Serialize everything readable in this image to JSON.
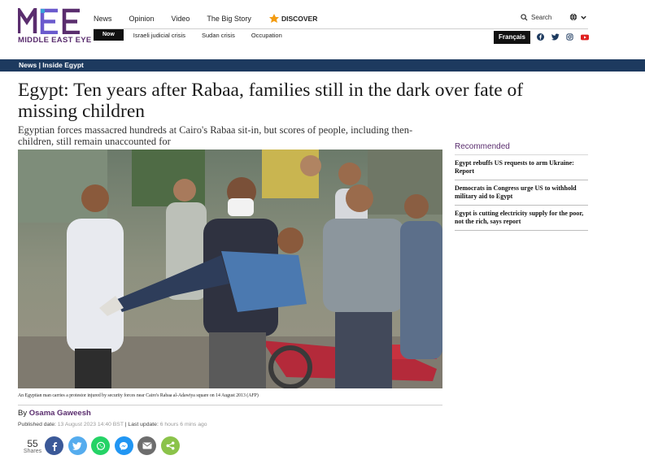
{
  "brand": {
    "logo_text": "MIDDLE EAST EYE",
    "color": "#5a2d6e"
  },
  "nav": {
    "items": [
      "News",
      "Opinion",
      "Video",
      "The Big Story"
    ],
    "discover_label": "DISCOVER",
    "search_label": "Search"
  },
  "subnav": {
    "now_label": "Now",
    "items": [
      "Israeli judicial crisis",
      "Sudan crisis",
      "Occupation"
    ],
    "language_button": "Français"
  },
  "section": {
    "label": "News | Inside Egypt",
    "bar_color": "#1d3a5f"
  },
  "article": {
    "headline": "Egypt: Ten years after Rabaa, families still in the dark over fate of missing children",
    "standfirst": "Egyptian forces massacred hundreds at Cairo's Rabaa sit-in, but scores of people, including then-children, still remain unaccounted for",
    "caption": "An Egyptian man carries a protestor injured by security forces near Cairo's Rabaa al-Adawiya square on 14 August 2013 (AFP)",
    "byline_prefix": "By",
    "author": "Osama Gaweesh",
    "published_label": "Published date:",
    "published_value": "13 August 2023 14:40 BST",
    "updated_label": "Last update:",
    "updated_value": "6 hours 6 mins ago"
  },
  "share": {
    "count": "55",
    "count_label": "Shares",
    "buttons": [
      {
        "icon": "facebook-icon",
        "color": "#3b5998"
      },
      {
        "icon": "twitter-icon",
        "color": "#55acee"
      },
      {
        "icon": "whatsapp-icon",
        "color": "#25d366"
      },
      {
        "icon": "messenger-icon",
        "color": "#2196f3"
      },
      {
        "icon": "email-icon",
        "color": "#6d6d6d"
      },
      {
        "icon": "share-icon",
        "color": "#8bc34a"
      }
    ]
  },
  "sidebar": {
    "title": "Recommended",
    "items": [
      "Egypt rebuffs US requests to arm Ukraine: Report",
      "Democrats in Congress urge US to withhold military aid to Egypt",
      "Egypt is cutting electricity supply for the poor, not the rich, says report"
    ]
  },
  "social_top": [
    "facebook-icon",
    "twitter-icon",
    "instagram-icon",
    "youtube-icon"
  ]
}
